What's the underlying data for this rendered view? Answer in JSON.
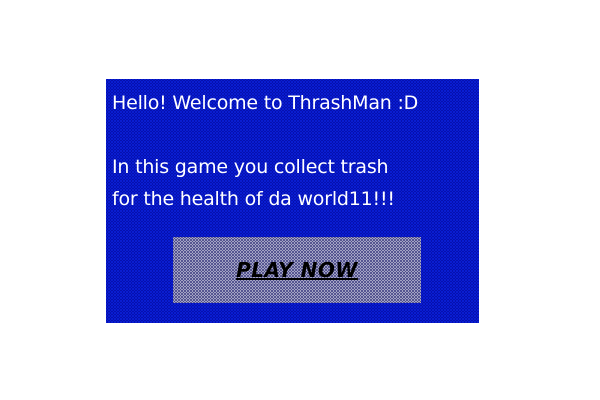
{
  "dialog": {
    "greeting": "Hello! Welcome to ThrashMan :D",
    "description_line1": "In this game you collect trash",
    "description_line2": "for the health of da world11!!!",
    "play_button_label": "PLAY NOW"
  },
  "colors": {
    "dialog_background": "#00008b",
    "text": "#ffffff",
    "button_label": "#000000"
  }
}
